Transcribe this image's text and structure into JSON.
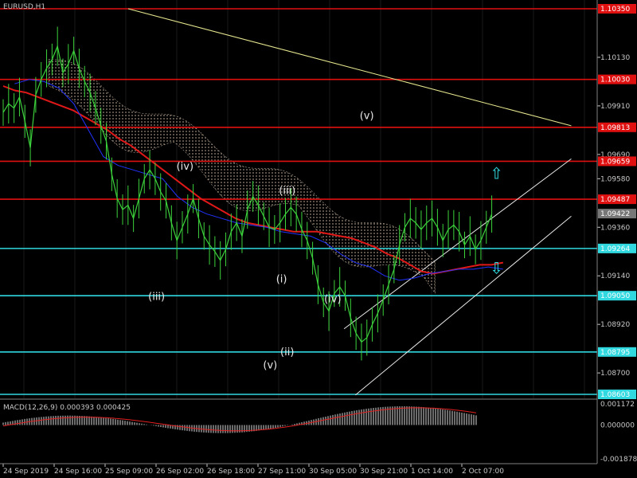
{
  "title": "EURUSD,H1",
  "colors": {
    "background": "#000000",
    "grid": "#1a1a1a",
    "axis": "#c8c8c8",
    "price": "#3cd23c",
    "ma_red": "#e01818",
    "ma_blue": "#2233ff",
    "trend": "#e8e890",
    "channel": "#e8e8e8",
    "res": "#e01010",
    "sup": "#30d8e0",
    "cloud": "#c8b4a0",
    "macd": "#d8d8d8",
    "signal": "#e02020",
    "tag_res": "#e01010",
    "tag_sup": "#30d8e0",
    "tag_cur": "#777777"
  },
  "chart_data": {
    "type": "line",
    "price_axis": {
      "ylim": [
        1.08603,
        1.1035
      ],
      "ticks": [
        "1.10130",
        "1.09910",
        "1.09690",
        "1.09580",
        "1.09360",
        "1.09140",
        "1.08920",
        "1.08700"
      ],
      "tick_values": [
        1.1013,
        1.0991,
        1.0969,
        1.0958,
        1.0936,
        1.0914,
        1.0892,
        1.087
      ]
    },
    "levels": [
      {
        "label": "1.10350",
        "value": 1.1035,
        "kind": "res"
      },
      {
        "label": "1.10030",
        "value": 1.1003,
        "kind": "res"
      },
      {
        "label": "1.09813",
        "value": 1.09813,
        "kind": "res"
      },
      {
        "label": "1.09659",
        "value": 1.09659,
        "kind": "res"
      },
      {
        "label": "1.09487",
        "value": 1.09487,
        "kind": "res"
      },
      {
        "label": "1.09422",
        "value": 1.09422,
        "kind": "cur"
      },
      {
        "label": "1.09264",
        "value": 1.09264,
        "kind": "sup"
      },
      {
        "label": "1.09050",
        "value": 1.0905,
        "kind": "sup"
      },
      {
        "label": "1.08795",
        "value": 1.08795,
        "kind": "sup"
      },
      {
        "label": "1.08603",
        "value": 1.08603,
        "kind": "sup"
      }
    ],
    "x_ticks": [
      "24 Sep 2019",
      "24 Sep 16:00",
      "25 Sep 09:00",
      "26 Sep 02:00",
      "26 Sep 18:00",
      "27 Sep 11:00",
      "30 Sep 05:00",
      "30 Sep 21:00",
      "1 Oct 14:00",
      "2 Oct 07:00"
    ],
    "bars": 105,
    "price_close": [
      1.0988,
      1.0992,
      1.099,
      1.0995,
      1.0984,
      1.0972,
      1.0996,
      1.1003,
      1.1008,
      1.1012,
      1.1018,
      1.1006,
      1.101,
      1.1016,
      1.1008,
      1.1002,
      1.0997,
      1.099,
      1.0982,
      1.0975,
      1.096,
      1.0949,
      1.0944,
      1.0946,
      1.094,
      1.0949,
      1.0958,
      1.0962,
      1.0958,
      1.0952,
      1.0948,
      1.0938,
      1.093,
      1.0936,
      1.0942,
      1.0949,
      1.094,
      1.0932,
      1.0928,
      1.0925,
      1.0921,
      1.0926,
      1.0934,
      1.0938,
      1.0932,
      1.0944,
      1.095,
      1.0946,
      1.0941,
      1.0936,
      1.0935,
      1.0938,
      1.0942,
      1.0945,
      1.0942,
      1.0935,
      1.093,
      1.0922,
      1.091,
      1.0902,
      1.0898,
      1.0906,
      1.0909,
      1.0905,
      1.0895,
      1.0888,
      1.0884,
      1.0886,
      1.0892,
      1.0897,
      1.0903,
      1.091,
      1.0917,
      1.0928,
      1.0936,
      1.094,
      1.0938,
      1.0935,
      1.0938,
      1.094,
      1.0936,
      1.093,
      1.0935,
      1.0937,
      1.0934,
      1.0928,
      1.0932,
      1.0926,
      1.093,
      1.0936,
      1.0942
    ],
    "ma_red": [
      1.1,
      1.0998,
      1.0997,
      1.0995,
      1.0993,
      1.0991,
      1.0989,
      1.0986,
      1.0983,
      1.098,
      1.0976,
      1.0973,
      1.0969,
      1.0965,
      1.0961,
      1.0957,
      1.0953,
      1.0949,
      1.0946,
      1.0943,
      1.094,
      1.0938,
      1.0937,
      1.0936,
      1.0935,
      1.0934,
      1.0934,
      1.0934,
      1.0933,
      1.0932,
      1.0931,
      1.0929,
      1.0927,
      1.0924,
      1.0922,
      1.0919,
      1.0916,
      1.0915,
      1.0916,
      1.0917,
      1.0918,
      1.0919,
      1.0919,
      1.092
    ],
    "ma_blue": [
      1.1001,
      1.1003,
      1.1002,
      1.0999,
      1.0992,
      1.098,
      1.0968,
      1.0964,
      1.0962,
      1.096,
      1.0958,
      1.095,
      1.0945,
      1.0942,
      1.094,
      1.0938,
      1.0937,
      1.0936,
      1.0934,
      1.0933,
      1.0932,
      1.0929,
      1.0924,
      1.092,
      1.0918,
      1.0914,
      1.0912,
      1.0913,
      1.0915,
      1.0916,
      1.0917,
      1.0917,
      1.0918,
      1.0917
    ],
    "wave_labels": [
      {
        "text": "(iv)",
        "bar": 32,
        "value": 1.0962
      },
      {
        "text": "(iii)",
        "bar": 27,
        "value": 1.0903
      },
      {
        "text": "(iii)",
        "bar": 50,
        "value": 1.0951
      },
      {
        "text": "(i)",
        "bar": 49,
        "value": 1.0911
      },
      {
        "text": "(ii)",
        "bar": 50,
        "value": 1.0878
      },
      {
        "text": "(v)",
        "bar": 47,
        "value": 1.0872
      },
      {
        "text": "(iv)",
        "bar": 58,
        "value": 1.0902
      },
      {
        "text": "(v)",
        "bar": 64,
        "value": 1.0985
      }
    ],
    "macd": {
      "label": "MACD(12,26,9) 0.000393 0.000425",
      "ticks": [
        "0.001172",
        "0.000000",
        "-0.001878"
      ],
      "tick_values": [
        0.001172,
        0,
        -0.001878
      ]
    }
  }
}
